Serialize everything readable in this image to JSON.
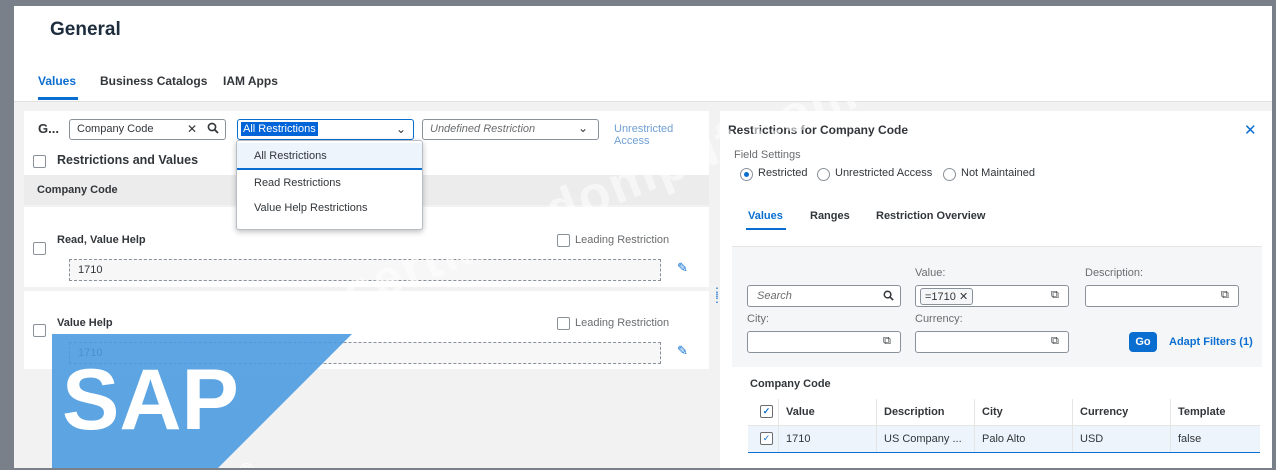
{
  "page": {
    "title": "General"
  },
  "tabs": [
    {
      "label": "Values"
    },
    {
      "label": "Business Catalogs"
    },
    {
      "label": "IAM Apps"
    }
  ],
  "toolbar": {
    "group_label": "G...",
    "field_value": "Company Code",
    "restriction_select": "All Restrictions",
    "undefined_select": "Undefined Restriction",
    "unrestricted_link": "Unrestricted Access"
  },
  "list": {
    "header": "Restrictions and Values",
    "section": "Company Code",
    "cards": [
      {
        "title": "Read, Value Help",
        "leading": "Leading Restriction",
        "value": "1710"
      },
      {
        "title": "Value Help",
        "leading": "Leading Restriction",
        "value": "1710"
      }
    ]
  },
  "dropdown": {
    "options": [
      "All Restrictions",
      "Read Restrictions",
      "Value Help Restrictions"
    ]
  },
  "panel": {
    "title": "Restrictions for Company Code",
    "field_settings_label": "Field Settings",
    "radios": [
      {
        "label": "Restricted",
        "selected": true
      },
      {
        "label": "Unrestricted Access",
        "selected": false
      },
      {
        "label": "Not Maintained",
        "selected": false
      }
    ],
    "tabs": [
      "Values",
      "Ranges",
      "Restriction Overview"
    ],
    "filters": {
      "search_placeholder": "Search",
      "value_label": "Value:",
      "value_token": "=1710",
      "description_label": "Description:",
      "city_label": "City:",
      "currency_label": "Currency:",
      "go_label": "Go",
      "adapt_label": "Adapt Filters (1)"
    },
    "table_title": "Company Code",
    "columns": [
      "Value",
      "Description",
      "City",
      "Currency",
      "Template"
    ],
    "rows": [
      {
        "value": "1710",
        "description": "US Company ...",
        "city": "Palo Alto",
        "currency": "USD",
        "template": "false"
      }
    ]
  },
  "overlay": {
    "watermark": "certkingdompdf.com",
    "logo_text": "SAP",
    "logo_mark": "®"
  },
  "colors": {
    "accent": "#0a6ed1",
    "logo_blue": "#3a8fd8"
  }
}
